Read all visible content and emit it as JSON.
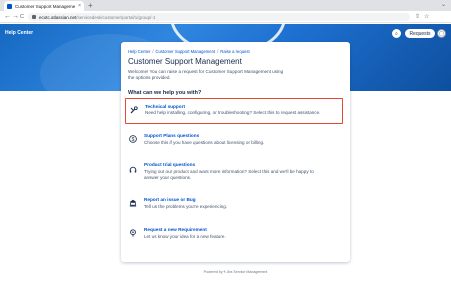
{
  "browser": {
    "tab_title": "Customer Support Manageme",
    "tab_close": "×",
    "new_tab": "+",
    "window_menu": "⌄",
    "back": "←",
    "forward": "→",
    "reload": "C",
    "url_host": "ecotc.atlassian.net",
    "url_path": "/servicedesk/customer/portal/1/group/-1",
    "share_icon": "⇧",
    "star_icon": "☆"
  },
  "header": {
    "help_center": "Help Center",
    "search_icon": "⌕",
    "requests_label": "Requests",
    "avatar_glyph": "◯"
  },
  "breadcrumb": {
    "items": [
      "Help Center",
      "Customer Support Management",
      "Raise a request"
    ],
    "separator": "/"
  },
  "page": {
    "title": "Customer Support Management",
    "welcome": "Welcome! You can raise a request for Customer Support Management using the options provided.",
    "section_heading": "What can we help you with?"
  },
  "request_types": [
    {
      "name": "Technical support",
      "description": "Need help installing, configuring, or troubleshooting? Select this to request assistance.",
      "icon": "wrench-icon",
      "selected": true
    },
    {
      "name": "Support Plans questions",
      "description": "Choose this if you have questions about licensing or billing.",
      "icon": "dollar-icon",
      "selected": false
    },
    {
      "name": "Product trial questions",
      "description": "Trying out our product and want more information? Select this and we'll be happy to answer your questions.",
      "icon": "headset-icon",
      "selected": false
    },
    {
      "name": "Report an issue or Bug",
      "description": "Tell us the problems you're experiencing.",
      "icon": "bug-icon",
      "selected": false
    },
    {
      "name": "Request a new Requirement",
      "description": "Let us know your idea for a new feature.",
      "icon": "lightbulb-icon",
      "selected": false
    }
  ],
  "footer": {
    "prefix": "Powered by",
    "bolt": "ϟ",
    "product": "Jira Service Management"
  },
  "colors": {
    "brand_blue": "#0052cc",
    "selection_outline": "#e34935",
    "banner_blue": "#1669c1"
  }
}
